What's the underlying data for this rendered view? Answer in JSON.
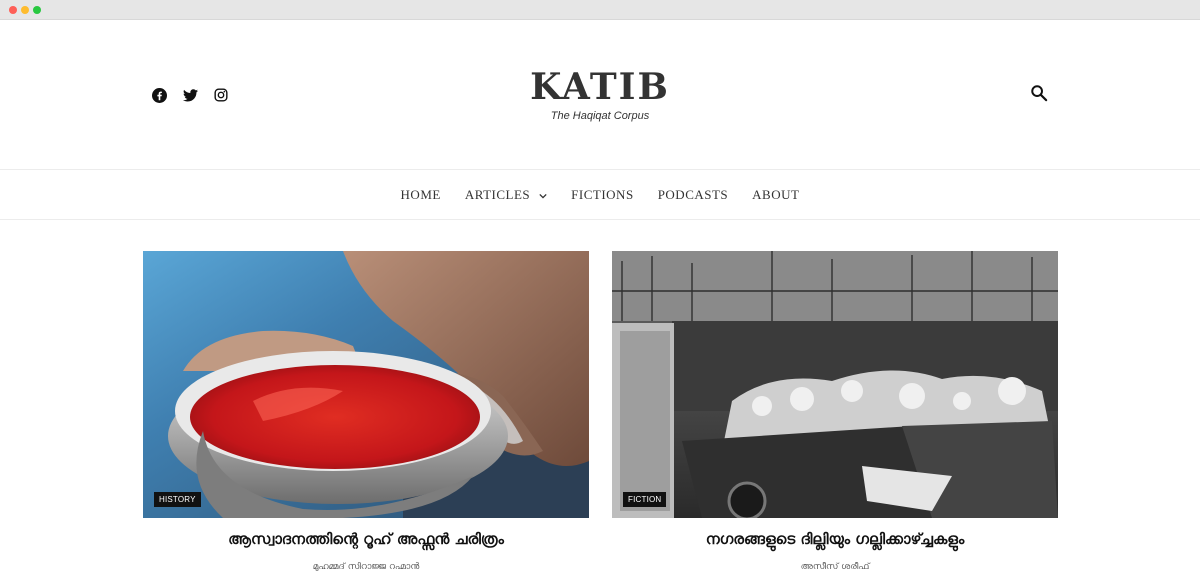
{
  "window": {
    "controls": {
      "close_color": "#fe5f57",
      "minimize_color": "#febc2e",
      "maximize_color": "#28c840"
    }
  },
  "social": {
    "icons": [
      "facebook-icon",
      "twitter-icon",
      "instagram-icon"
    ]
  },
  "brand": {
    "logo": "KATIB",
    "tagline": "The Haqiqat Corpus"
  },
  "search": {
    "icon": "search-icon"
  },
  "nav": {
    "items": [
      {
        "label": "HOME"
      },
      {
        "label": "ARTICLES",
        "has_dropdown": true
      },
      {
        "label": "FICTIONS"
      },
      {
        "label": "PODCASTS"
      },
      {
        "label": "ABOUT"
      }
    ]
  },
  "posts": [
    {
      "category": "HISTORY",
      "title": "ആസ്വാദനത്തിന്റെ റൂഹ് അഫ്സൻ ചരിത്രം",
      "author": "മുഹമ്മദ് സിറാജ്ജ റഹ്മാൻ",
      "image": "man-drinking-red-drink-photo"
    },
    {
      "category": "FICTION",
      "title": "നഗരങ്ങളുടെ ദില്ലിയും ഗല്ലിക്കാഴ്ച്ചകളും",
      "author": "അസീസ് ശരീഫ്",
      "image": "garbage-cart-bw-photo"
    }
  ]
}
